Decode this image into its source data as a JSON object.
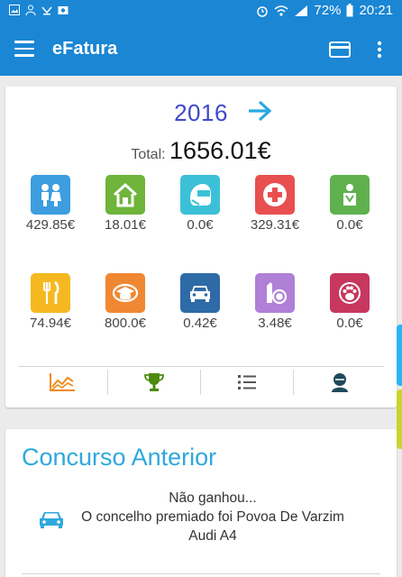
{
  "status_bar": {
    "battery": "72%",
    "time": "20:21"
  },
  "app_bar": {
    "title": "eFatura"
  },
  "summary": {
    "year": "2016",
    "total_label": "Total:",
    "total_value": "1656.01€",
    "categories": [
      {
        "icon": "family-icon",
        "color": "#3d9ddf",
        "value": "429.85€"
      },
      {
        "icon": "house-icon",
        "color": "#6fb43b",
        "value": "18.01€"
      },
      {
        "icon": "helmet-icon",
        "color": "#3cc0d8",
        "value": "0.0€"
      },
      {
        "icon": "health-cross-icon",
        "color": "#e8504f",
        "value": "329.31€"
      },
      {
        "icon": "person-icon",
        "color": "#5fb14e",
        "value": "0.0€"
      },
      {
        "icon": "fork-knife-icon",
        "color": "#f5b820",
        "value": "74.94€"
      },
      {
        "icon": "graduation-cap-icon",
        "color": "#f08732",
        "value": "800.0€"
      },
      {
        "icon": "car-icon",
        "color": "#2e6aa6",
        "value": "0.42€"
      },
      {
        "icon": "beauty-icon",
        "color": "#b07fd6",
        "value": "3.48€"
      },
      {
        "icon": "paw-icon",
        "color": "#c7375e",
        "value": "0.0€"
      }
    ],
    "tabs": [
      {
        "icon": "chart-icon",
        "color": "#f08a1a"
      },
      {
        "icon": "trophy-icon",
        "color": "#4f8a10"
      },
      {
        "icon": "list-icon",
        "color": "#555555"
      },
      {
        "icon": "user-icon",
        "color": "#1f4a5a"
      }
    ]
  },
  "contest": {
    "title": "Concurso Anterior",
    "line1": "Não ganhou...",
    "line2": "O concelho premiado foi Povoa De Varzim",
    "line3": "Audi A4"
  }
}
